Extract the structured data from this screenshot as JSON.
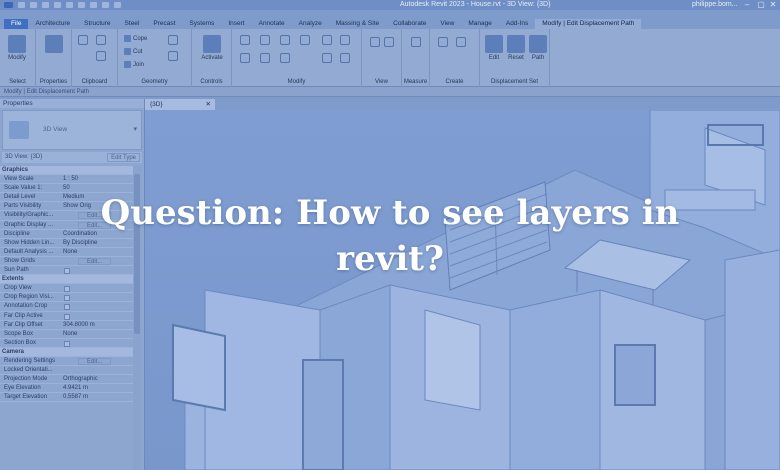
{
  "window": {
    "title": "Autodesk Revit 2023 - House.rvt - 3D View: {3D}",
    "user": "philippe.bom..."
  },
  "ribbon_tabs": [
    "File",
    "Architecture",
    "Structure",
    "Steel",
    "Precast",
    "Systems",
    "Insert",
    "Annotate",
    "Analyze",
    "Massing & Site",
    "Collaborate",
    "View",
    "Manage",
    "Add-Ins",
    "Modify | Edit Displacement Path"
  ],
  "ribbon": {
    "select": {
      "button": "Modify",
      "label": "Select"
    },
    "properties": {
      "label": "Properties"
    },
    "clipboard": {
      "label": "Clipboard"
    },
    "geometry": {
      "cope": "Cope",
      "cut": "Cut",
      "join": "Join",
      "label": "Geometry"
    },
    "controls": {
      "activate": "Activate",
      "label": "Controls"
    },
    "modify": {
      "label": "Modify"
    },
    "view": {
      "label": "View"
    },
    "measure": {
      "label": "Measure"
    },
    "create": {
      "label": "Create"
    },
    "displacement": {
      "edit": "Edit",
      "reset": "Reset",
      "path": "Path",
      "label": "Displacement Set"
    }
  },
  "options_bar": "Modify | Edit Displacement Path",
  "properties_palette": {
    "title": "Properties",
    "type_name": "3D View",
    "instance": "3D View: {3D}",
    "edit_type": "Edit Type",
    "rows": [
      {
        "group": "Graphics"
      },
      {
        "k": "View Scale",
        "v": "1 : 50"
      },
      {
        "k": "Scale Value 1:",
        "v": "50"
      },
      {
        "k": "Detail Level",
        "v": "Medium"
      },
      {
        "k": "Parts Visibility",
        "v": "Show Orig"
      },
      {
        "k": "Visibility/Graphic...",
        "edit": "Edit..."
      },
      {
        "k": "Graphic Display ...",
        "edit": "Edit..."
      },
      {
        "k": "Discipline",
        "v": "Coordination"
      },
      {
        "k": "Show Hidden Lin...",
        "v": "By Discipline"
      },
      {
        "k": "Default Analysis ...",
        "v": "None"
      },
      {
        "k": "Show Grids",
        "edit": "Edit..."
      },
      {
        "k": "Sun Path",
        "check": true
      },
      {
        "group": "Extents"
      },
      {
        "k": "Crop View",
        "check": true
      },
      {
        "k": "Crop Region Visi...",
        "check": true
      },
      {
        "k": "Annotation Crop",
        "check": true
      },
      {
        "k": "Far Clip Active",
        "check": true
      },
      {
        "k": "Far Clip Offset",
        "v": "304.8000 m"
      },
      {
        "k": "Scope Box",
        "v": "None"
      },
      {
        "k": "Section Box",
        "check": true
      },
      {
        "group": "Camera"
      },
      {
        "k": "Rendering Settings",
        "edit": "Edit..."
      },
      {
        "k": "Locked Orientati...",
        "v": ""
      },
      {
        "k": "Projection Mode",
        "v": "Orthographic"
      },
      {
        "k": "Eye Elevation",
        "v": "4.9421 m"
      },
      {
        "k": "Target Elevation",
        "v": "0.5587 m"
      }
    ]
  },
  "view_tab": {
    "label": "{3D}",
    "close": "✕"
  },
  "headline": {
    "line1": "Question: How to see layers in",
    "line2": "revit?"
  }
}
